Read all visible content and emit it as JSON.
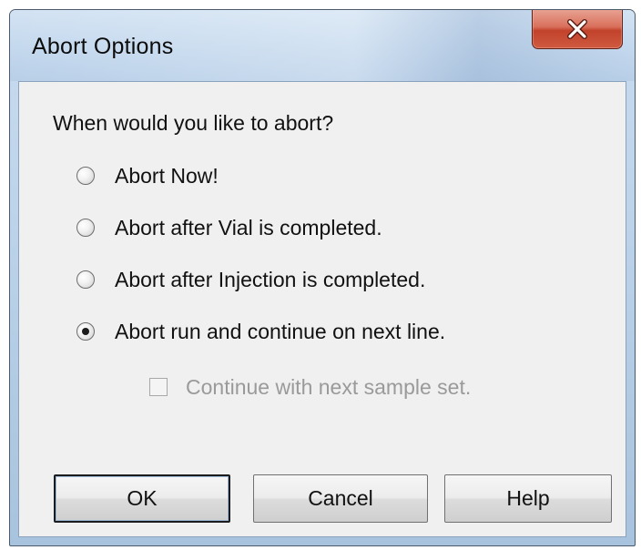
{
  "window": {
    "title": "Abort Options",
    "close_glyph": "X"
  },
  "dialog": {
    "prompt": "When would you like to abort?",
    "options": [
      {
        "label": "Abort Now!",
        "checked": false
      },
      {
        "label": "Abort after Vial is completed.",
        "checked": false
      },
      {
        "label": "Abort after Injection is completed.",
        "checked": false
      },
      {
        "label": "Abort run and continue on next line.",
        "checked": true
      }
    ],
    "continue_checkbox": {
      "label": "Continue with next sample set.",
      "checked": false,
      "enabled": false
    }
  },
  "buttons": {
    "ok": "OK",
    "cancel": "Cancel",
    "help": "Help"
  },
  "icons": {
    "close": "close-icon",
    "radio": "radio-button-icon",
    "checkbox": "checkbox-icon"
  },
  "colors": {
    "title_bar": "#c5d9ee",
    "close_button": "#c2422b",
    "client_background": "#f0f0f0",
    "disabled_text": "#9a9a9a"
  }
}
